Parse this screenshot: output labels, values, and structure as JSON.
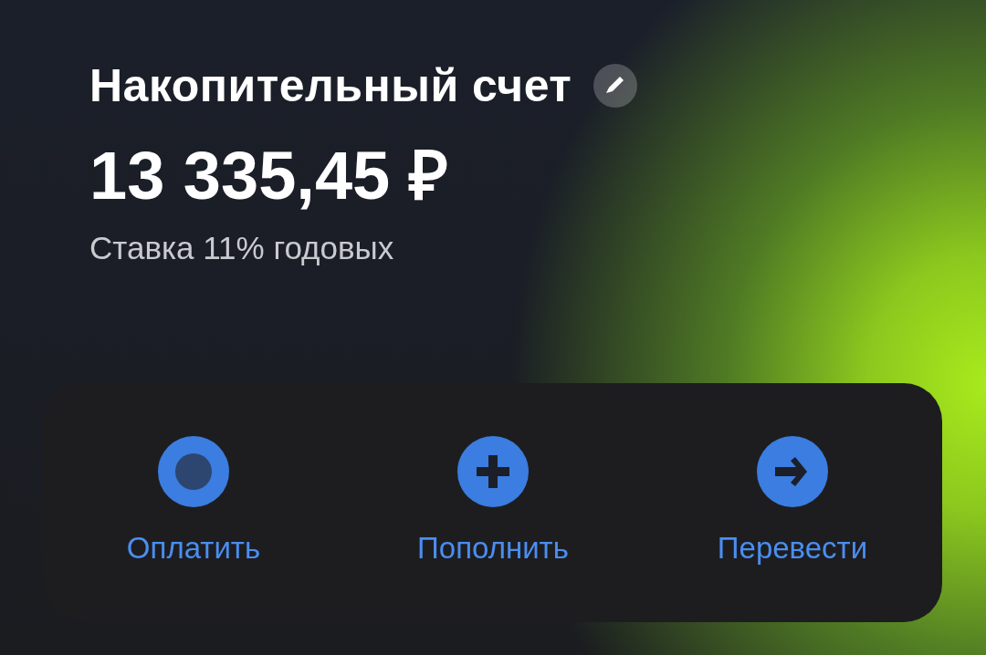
{
  "account": {
    "title": "Накопительный счет",
    "balance": "13 335,45 ₽",
    "rate": "Ставка 11% годовых"
  },
  "actions": [
    {
      "kind": "pay",
      "label": "Оплатить"
    },
    {
      "kind": "topup",
      "label": "Пополнить"
    },
    {
      "kind": "transfer",
      "label": "Перевести"
    }
  ]
}
